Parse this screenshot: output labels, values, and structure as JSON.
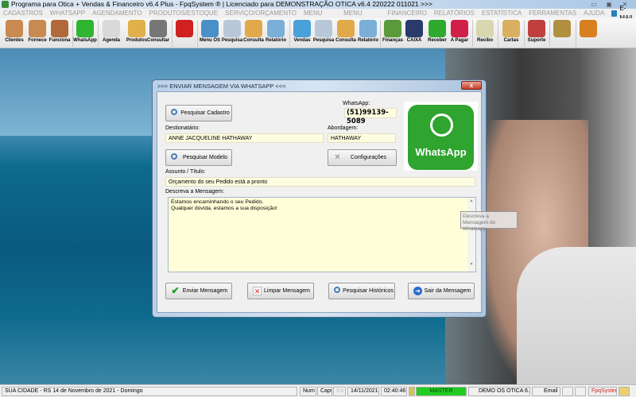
{
  "window": {
    "title": "Programa para Otica + Vendas & Financeiro v6.4 Plus - FpqSystem ® | Licenciado para  DEMONSTRAÇÃO OTICA v6.4 220222 011021 >>>"
  },
  "menu": [
    "CADASTROS",
    "WHATSAPP",
    "AGENDAMENTO",
    "PRODUTOS/ESTOQUE",
    "SERVIÇO/ORÇAMENTO",
    "MENU VENDAS",
    "MENU COMPRAS",
    "FINANCEIRO",
    "RELATÓRIOS",
    "ESTATÍSTICA",
    "FERRAMENTAS",
    "AJUDA"
  ],
  "menu_email": "E-MAIL",
  "toolbar": [
    {
      "label": "Clientes",
      "color": "#c98a52"
    },
    {
      "label": "Fornece",
      "color": "#c98a52"
    },
    {
      "label": "Funciona",
      "color": "#b06a3a"
    },
    {
      "label": "WhatsApp",
      "color": "#2fb52f"
    },
    {
      "label": "Agenda",
      "color": "#d9d9d9"
    },
    {
      "label": "Produtos",
      "color": "#e1b04a"
    },
    {
      "label": "Consultar",
      "color": "#777777"
    },
    {
      "label": "",
      "color": "#d02020"
    },
    {
      "label": "Menu OS",
      "color": "#4a90c8"
    },
    {
      "label": "Pesquisa",
      "color": "#b8c8d8"
    },
    {
      "label": "Consulta",
      "color": "#e2a94a"
    },
    {
      "label": "Relatório",
      "color": "#7ab0d8"
    },
    {
      "label": "Vendas",
      "color": "#4aa0d8"
    },
    {
      "label": "Pesquisa",
      "color": "#b8c8d8"
    },
    {
      "label": "Consulta",
      "color": "#e2a94a"
    },
    {
      "label": "Relatório",
      "color": "#7ab0d8"
    },
    {
      "label": "Finanças",
      "color": "#5a9a3a"
    },
    {
      "label": "CAIXA",
      "color": "#2a3a6a"
    },
    {
      "label": "Receber",
      "color": "#2faa2f"
    },
    {
      "label": "A Pagar",
      "color": "#d0204a"
    },
    {
      "label": "Recibo",
      "color": "#d8d8b0"
    },
    {
      "label": "Cartas",
      "color": "#d8b060"
    },
    {
      "label": "Suporte",
      "color": "#c04040"
    },
    {
      "label": "",
      "color": "#b09040"
    },
    {
      "label": "",
      "color": "#d88020"
    }
  ],
  "dialog": {
    "title": ">>> ENVIAR MENSAGEM VIA WHATSAPP <<<",
    "close": "x",
    "search_contact": "Pesquisar Cadastro",
    "whatsapp_label": "WhatsApp:",
    "whatsapp_number": "(51)99139-5089",
    "recipient_label": "Destionatário:",
    "recipient": "ANNE JACQUELINE HATHAWAY",
    "approach_label": "Abordagem:",
    "approach": "HATHAWAY",
    "search_template": "Pesquisar Modelo",
    "settings": "Configurações",
    "subject_label": "Assunto / Título:",
    "subject": "Orçamento do seu Pedido está a pronto",
    "message_label": "Descreva a Mensagem:",
    "message": "Estamos encaminhando o seu Pedido.\nQualquer dúvida, estamos a sua disposição!",
    "logo_text": "WhatsApp",
    "send": "Enviar Mensagem",
    "clear": "Limpar Mensagem",
    "history": "Pesquisar Históricos",
    "exit": "Sair da Mensagem",
    "tooltip": "Descreva a Mensagem do Whatsapp"
  },
  "status": {
    "location": "SUA CIDADE - RS 14 de Novembro de 2021 - Domingo",
    "num": "Num",
    "caps": "Caps",
    "ins": "Ins",
    "date": "14/11/2021",
    "time": "02:40:46",
    "user": "MASTER",
    "company": "DEMO OS OTICA 6.4",
    "email": "Email",
    "brand": "FpqSystem"
  },
  "colors": {
    "accent_green": "#2fa42f",
    "field_bg": "#fffde0",
    "status_green": "#22cc22"
  }
}
